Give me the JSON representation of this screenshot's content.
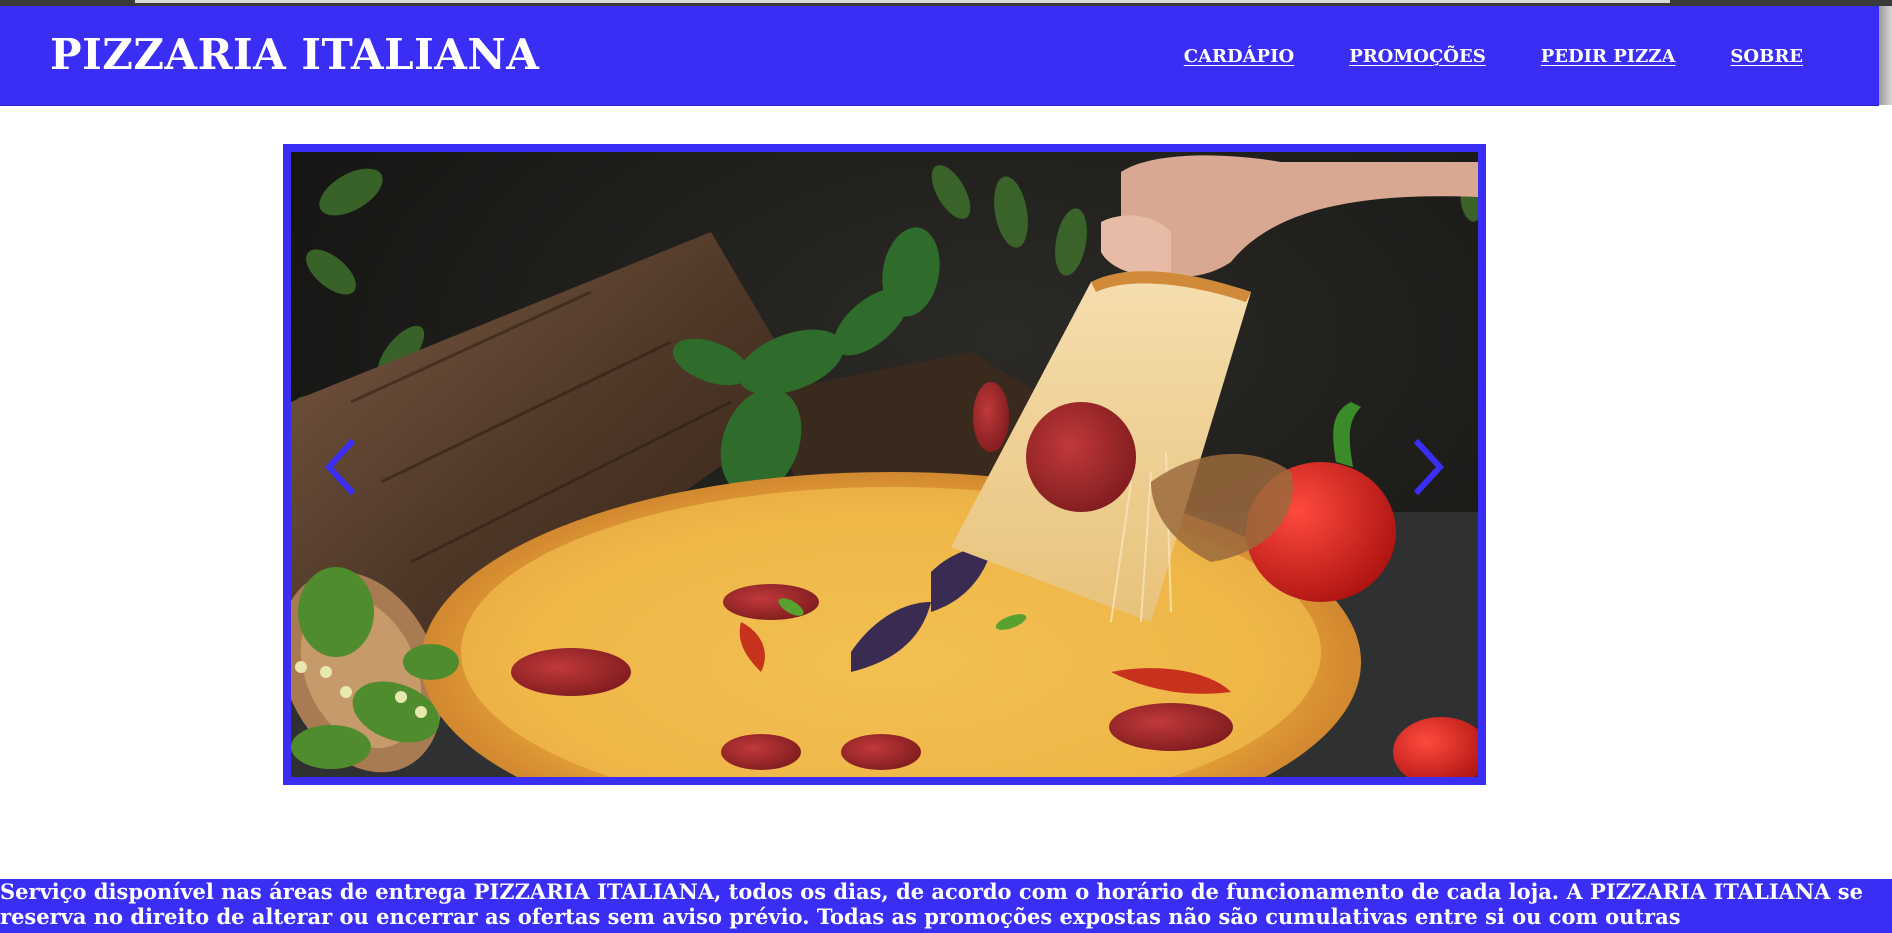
{
  "brand": {
    "title": "PIZZARIA ITALIANA"
  },
  "nav": {
    "items": [
      {
        "label": "CARDÁPIO"
      },
      {
        "label": "PROMOÇÕES"
      },
      {
        "label": "PEDIR PIZZA"
      },
      {
        "label": "SOBRE"
      }
    ]
  },
  "carousel": {
    "prev_icon": "chevron-left-icon",
    "next_icon": "chevron-right-icon"
  },
  "footer": {
    "notice": "Serviço disponível nas áreas de entrega PIZZARIA ITALIANA, todos os dias, de acordo com o horário de funcionamento de cada loja. A PIZZARIA ITALIANA se reserva no direito de alterar ou encerrar as ofertas sem aviso prévio. Todas as promoções expostas não são cumulativas entre si ou com outras"
  },
  "colors": {
    "accent": "#3a2ef5",
    "text_on_accent": "#ffffff",
    "background": "#ffffff"
  }
}
